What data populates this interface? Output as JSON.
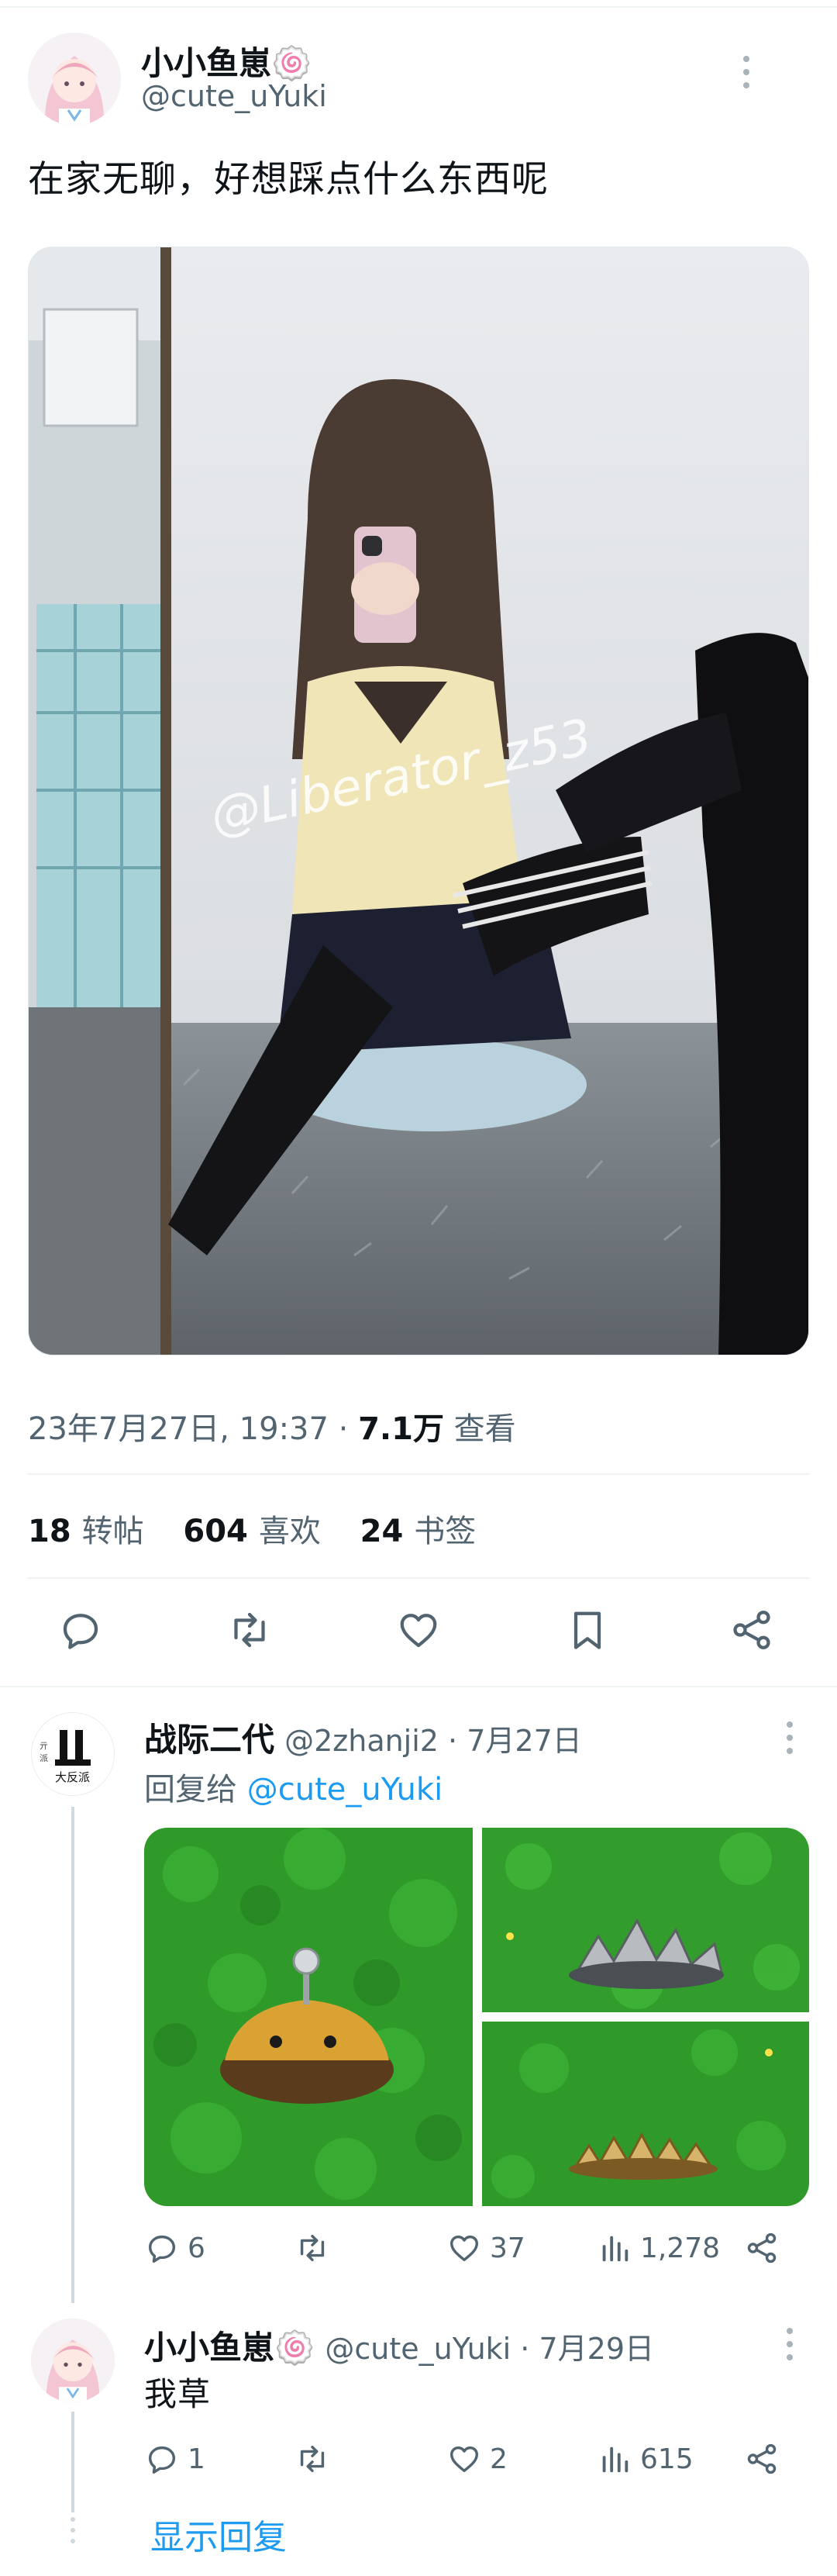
{
  "main_tweet": {
    "display_name": "小小鱼崽🍥",
    "handle": "@cute_uYuki",
    "text": "在家无聊，好想踩点什么东西呢",
    "watermark": "@Liberator_z53",
    "timestamp": "23年7月27日, 19:37 · ",
    "views_count": "7.1万",
    "views_label": " 查看",
    "retweets_count": "18",
    "retweets_label": "转帖",
    "likes_count": "604",
    "likes_label": "喜欢",
    "bookmarks_count": "24",
    "bookmarks_label": "书签"
  },
  "reply_1": {
    "display_name": "战际二代",
    "handle": "@2zhanji2 · 7月27日",
    "reply_prefix": "回复给 ",
    "reply_mention": "@cute_uYuki",
    "avatar_text_small": "大反派",
    "replies": "6",
    "retweets": "",
    "likes": "37",
    "views": "1,278"
  },
  "reply_2": {
    "display_name": "小小鱼崽🍥",
    "handle": "@cute_uYuki · 7月29日",
    "text": "我草",
    "replies": "1",
    "retweets": "",
    "likes": "2",
    "views": "615"
  },
  "show_replies": "显示回复",
  "icons": [
    "reply-icon",
    "retweet-icon",
    "like-icon",
    "bookmark-icon",
    "share-icon",
    "views-icon",
    "more-icon"
  ],
  "colors": {
    "link": "#1d9bf0",
    "secondary_text": "#536471",
    "divider": "#eff3f4"
  }
}
